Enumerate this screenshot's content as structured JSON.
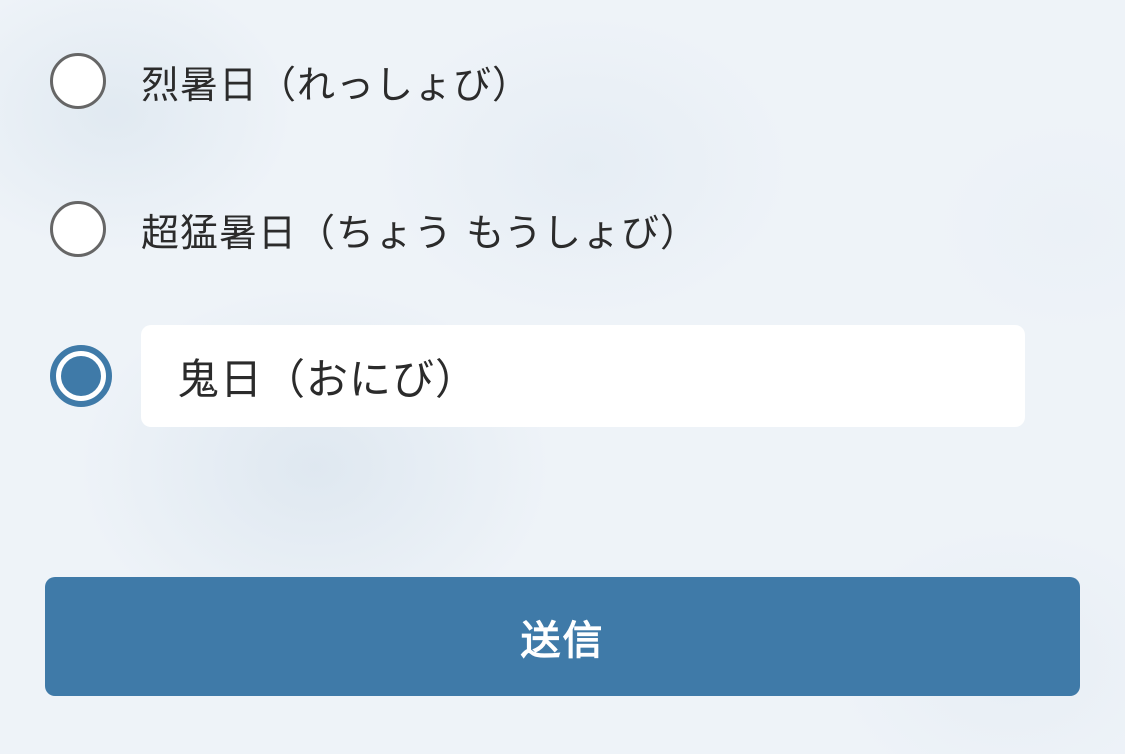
{
  "options": [
    {
      "label": "烈暑日（れっしょび）",
      "selected": false
    },
    {
      "label": "超猛暑日（ちょう もうしょび）",
      "selected": false
    },
    {
      "label": "鬼日（おにび）",
      "selected": true
    }
  ],
  "submit": {
    "label": "送信"
  },
  "colors": {
    "accent": "#3f7aa8",
    "radio_border": "#666666",
    "background": "#eef3f8"
  }
}
